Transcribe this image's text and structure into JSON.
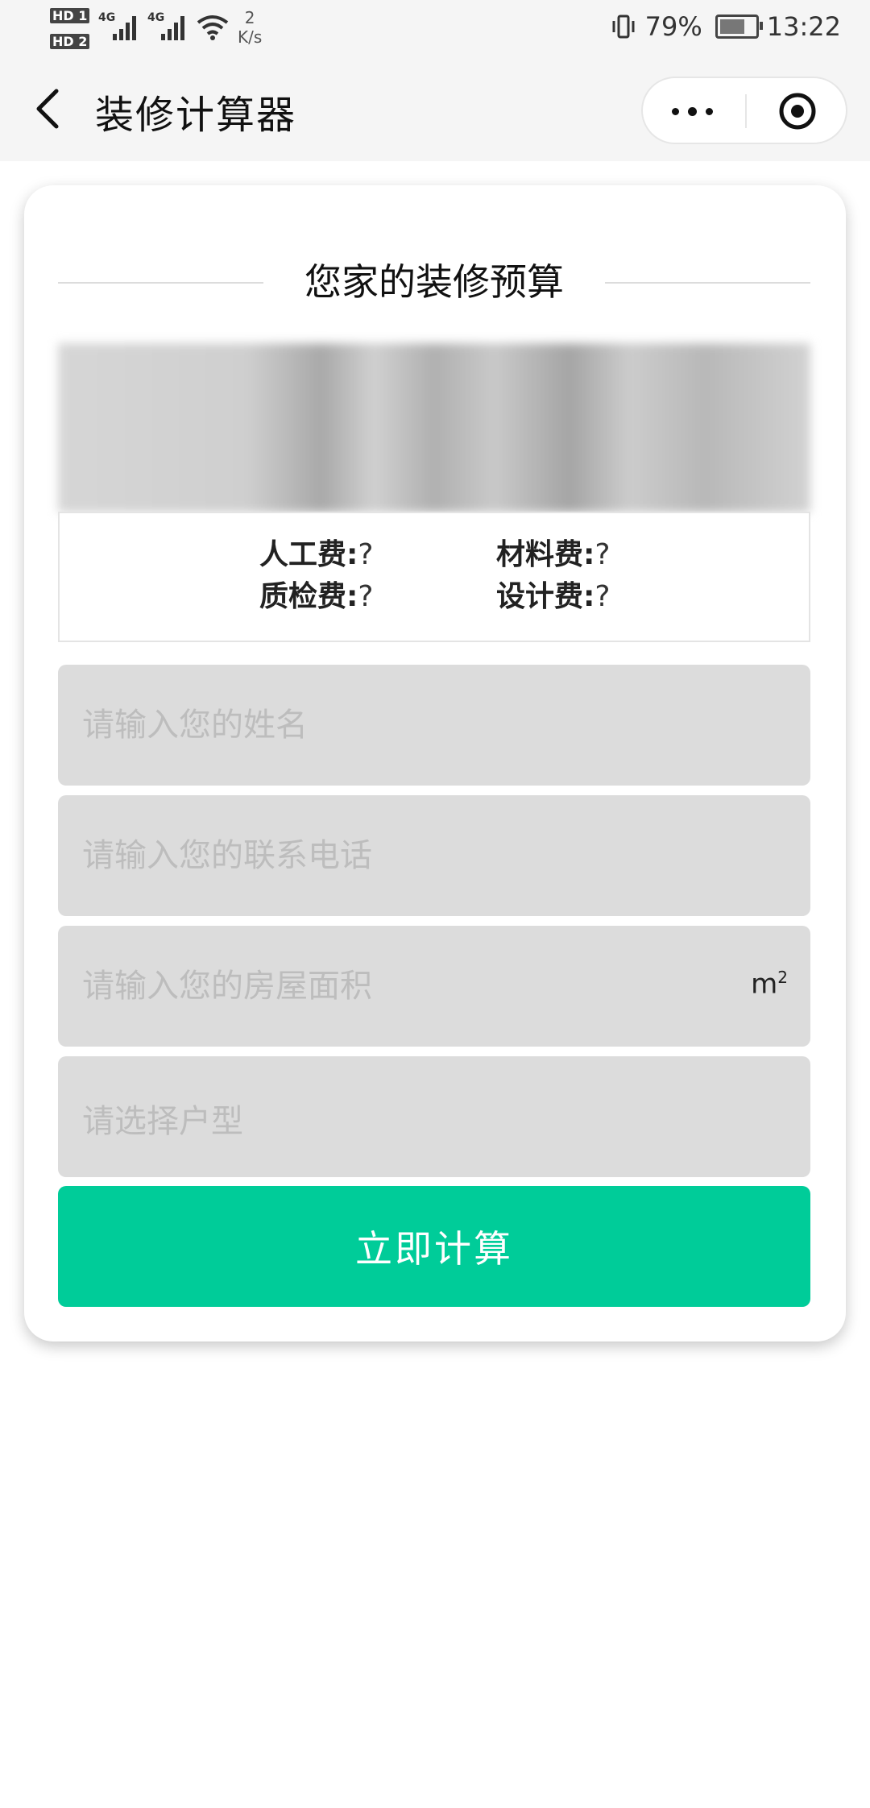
{
  "status_bar": {
    "sim1": "HD 1",
    "sim2": "HD 2",
    "net1": "4G",
    "net2": "4G",
    "speed_value": "2",
    "speed_unit": "K/s",
    "battery": "79%",
    "time": "13:22"
  },
  "nav": {
    "title": "装修计算器"
  },
  "card": {
    "heading": "您家的装修预算",
    "fees": {
      "labor_label": "人工费:",
      "labor_value": "?",
      "material_label": "材料费:",
      "material_value": "?",
      "quality_label": "质检费:",
      "quality_value": "?",
      "design_label": "设计费:",
      "design_value": "?"
    },
    "fields": {
      "name_placeholder": "请输入您的姓名",
      "phone_placeholder": "请输入您的联系电话",
      "area_placeholder": "请输入您的房屋面积",
      "area_unit": "m",
      "area_unit_exp": "2",
      "type_placeholder": "请选择户型"
    },
    "submit_label": "立即计算"
  },
  "colors": {
    "accent": "#00cc99",
    "field_bg": "#dcdcdc",
    "placeholder": "#bdbdbd"
  }
}
